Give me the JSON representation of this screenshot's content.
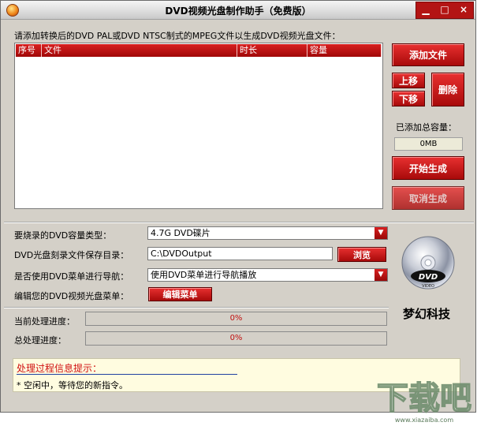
{
  "window": {
    "title": "DVD视频光盘制作助手（免费版）",
    "minimize": "▁",
    "maximize": "□",
    "close": "×"
  },
  "file_list": {
    "prompt": "请添加转换后的DVD PAL或DVD NTSC制式的MPEG文件以生成DVD视频光盘文件：",
    "columns": [
      "序号",
      "文件",
      "时长",
      "容量"
    ]
  },
  "buttons": {
    "add_file": "添加文件",
    "move_up": "上移",
    "move_down": "下移",
    "delete": "删除",
    "start": "开始生成",
    "cancel": "取消生成",
    "browse": "浏览",
    "edit_menu": "编辑菜单"
  },
  "total_capacity": {
    "label": "已添加总容量：",
    "value": "0MB"
  },
  "settings": {
    "capacity_type_label": "要烧录的DVD容量类型：",
    "capacity_type_value": "4.7G DVD碟片",
    "output_dir_label": "DVD光盘刻录文件保存目录：",
    "output_dir_value": "C:\\DVDOutput",
    "menu_nav_label": "是否使用DVD菜单进行导航：",
    "menu_nav_value": "使用DVD菜单进行导航播放",
    "edit_menu_label": "编辑您的DVD视频光盘菜单："
  },
  "progress": {
    "current_label": "当前处理进度：",
    "current_value": "0%",
    "total_label": "总处理进度：",
    "total_value": "0%"
  },
  "brand": {
    "logo_text": "DVD",
    "logo_sub": "VIDEO",
    "name": "梦幻科技"
  },
  "info": {
    "title": "处理过程信息提示：",
    "message": "* 空闲中，等待您的新指令。"
  },
  "watermark": {
    "text": "下载吧",
    "url": "www.xiazaiba.com"
  },
  "colors": {
    "accent": "#b31414",
    "window_bg": "#d4d0c8",
    "info_bg": "#fffce0"
  }
}
